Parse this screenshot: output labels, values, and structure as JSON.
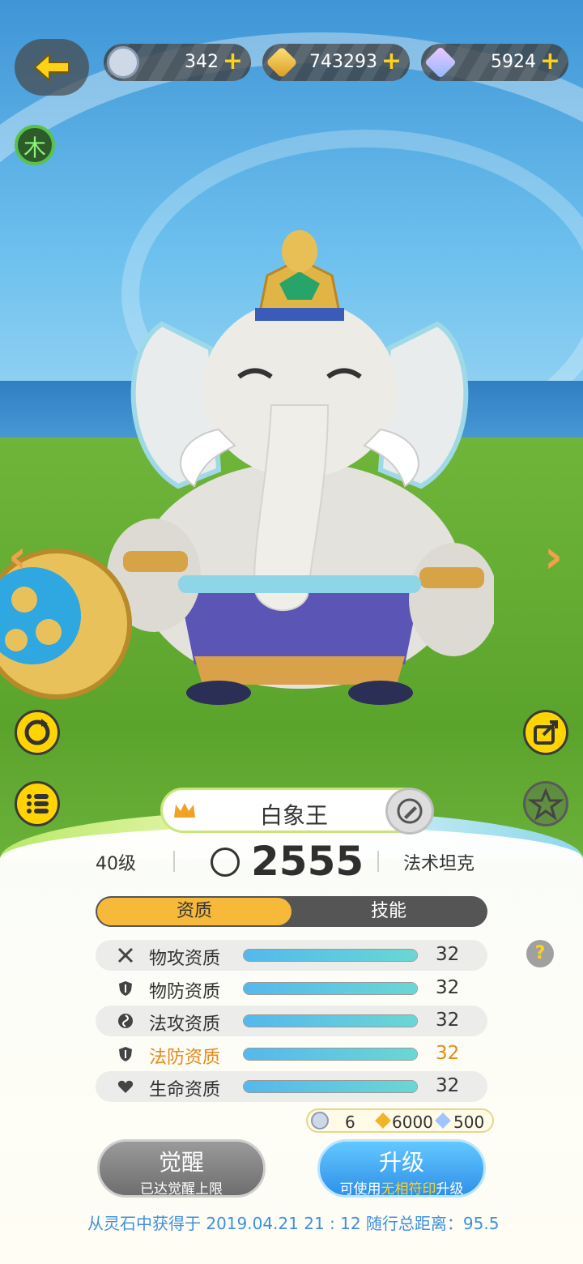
{
  "header": {
    "back_icon": "back-arrow-icon",
    "resources": [
      {
        "icon": "pet-token-icon",
        "value": "342",
        "plus": "+"
      },
      {
        "icon": "gold-crystal-icon",
        "value": "743293",
        "plus": "+"
      },
      {
        "icon": "diamond-icon",
        "value": "5924",
        "plus": "+"
      }
    ]
  },
  "element_badge": "木",
  "pet": {
    "name": "白象王",
    "level": "40级",
    "power": "2555",
    "role": "法术坦克"
  },
  "tabs": [
    {
      "label": "资质",
      "active": true
    },
    {
      "label": "技能",
      "active": false
    }
  ],
  "stats": [
    {
      "icon": "crossed-swords-icon",
      "label": "物攻资质",
      "value": "32",
      "level": 1.0,
      "highlight": false
    },
    {
      "icon": "shield-icon",
      "label": "物防资质",
      "value": "32",
      "level": 1.0,
      "highlight": false
    },
    {
      "icon": "swirl-icon",
      "label": "法攻资质",
      "value": "32",
      "level": 1.0,
      "highlight": false
    },
    {
      "icon": "shield-icon",
      "label": "法防资质",
      "value": "32",
      "level": 1.0,
      "highlight": true
    },
    {
      "icon": "heart-icon",
      "label": "生命资质",
      "value": "32",
      "level": 1.0,
      "highlight": false
    }
  ],
  "help": "?",
  "cost": {
    "token": "6",
    "gold": "6000",
    "diamond": "500"
  },
  "buttons": {
    "awaken_label": "觉醒",
    "awaken_sub": "已达觉醒上限",
    "upgrade_label": "升级",
    "upgrade_sub_pre": "可使用",
    "upgrade_sub_hl": "无相符印",
    "upgrade_sub_post": "升级"
  },
  "footer": "从灵石中获得于 2019.04.21   21 : 12   随行总距离：95.5",
  "colors": {
    "accent_yellow": "#ffd21a",
    "tab_active": "#f7b93a",
    "highlight_orange": "#e58a1c",
    "upgrade_blue": "#2f90e8",
    "footer_blue": "#3d8fe0"
  }
}
